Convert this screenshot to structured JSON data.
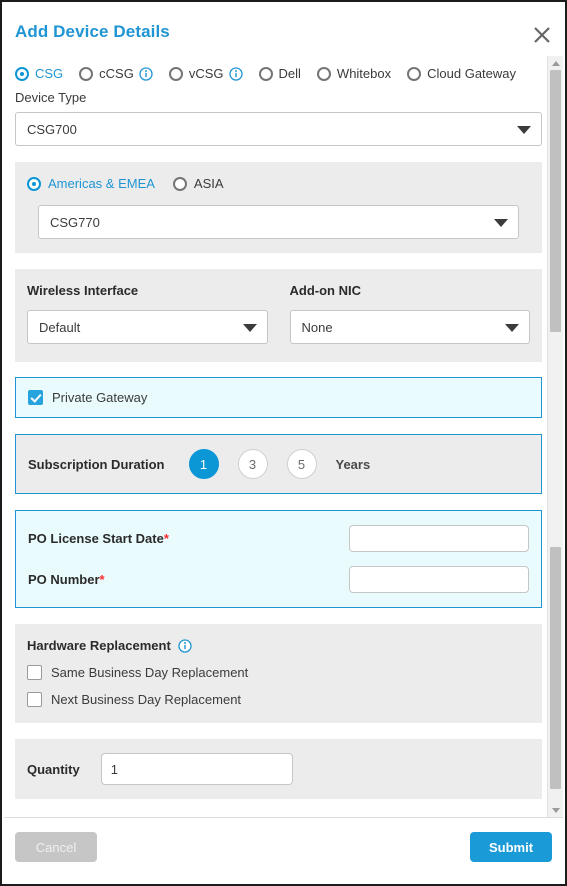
{
  "dialog": {
    "title": "Add Device Details",
    "close_icon": "close-icon"
  },
  "device_kinds": {
    "options": [
      {
        "label": "CSG",
        "selected": true,
        "info": false
      },
      {
        "label": "cCSG",
        "selected": false,
        "info": true
      },
      {
        "label": "vCSG",
        "selected": false,
        "info": true
      },
      {
        "label": "Dell",
        "selected": false,
        "info": false
      },
      {
        "label": "Whitebox",
        "selected": false,
        "info": false
      },
      {
        "label": "Cloud Gateway",
        "selected": false,
        "info": false
      }
    ]
  },
  "device_type": {
    "label": "Device Type",
    "value": "CSG700"
  },
  "region": {
    "options": [
      {
        "label": "Americas & EMEA",
        "selected": true
      },
      {
        "label": "ASIA",
        "selected": false
      }
    ],
    "model_value": "CSG770"
  },
  "wireless": {
    "label": "Wireless Interface",
    "value": "Default"
  },
  "addon_nic": {
    "label": "Add-on NIC",
    "value": "None"
  },
  "private_gateway": {
    "label": "Private Gateway",
    "checked": true
  },
  "subscription": {
    "label": "Subscription Duration",
    "options": [
      "1",
      "3",
      "5"
    ],
    "selected": "1",
    "unit": "Years"
  },
  "po": {
    "start_date_label": "PO License Start Date",
    "start_date_required": "*",
    "start_date_value": "",
    "number_label": "PO Number",
    "number_required": "*",
    "number_value": ""
  },
  "hardware_replacement": {
    "label": "Hardware Replacement",
    "info_icon": "info-icon",
    "options": [
      {
        "label": "Same Business Day Replacement",
        "checked": false
      },
      {
        "label": "Next Business Day Replacement",
        "checked": false
      }
    ]
  },
  "quantity": {
    "label": "Quantity",
    "value": "1"
  },
  "footer": {
    "cancel_label": "Cancel",
    "submit_label": "Submit"
  },
  "colors": {
    "accent": "#2095d3",
    "accent_fill": "#0b96d5",
    "submit": "#1a9ad7",
    "panel_gray": "#ececec",
    "panel_highlight": "#e9fbfd",
    "required": "#ff2b2b",
    "cancel_disabled": "#c6c6c6"
  }
}
